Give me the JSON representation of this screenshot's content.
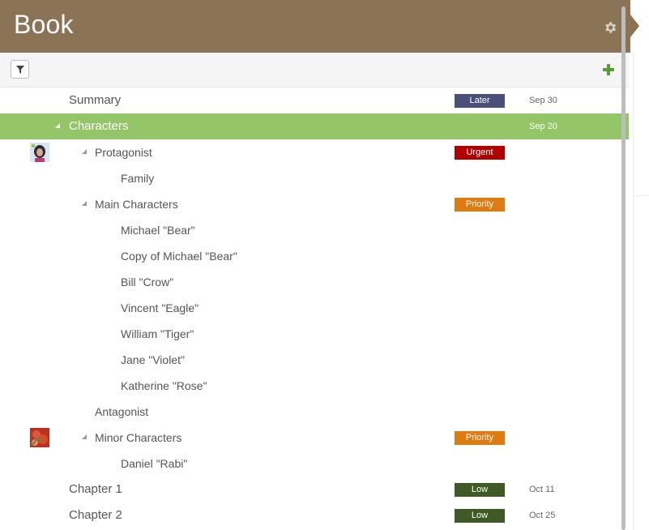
{
  "header": {
    "title": "Book"
  },
  "icons": {
    "settings": "gear-icon",
    "filter": "filter-icon",
    "add": "plus-icon"
  },
  "colors": {
    "header": "#8b7355",
    "selected_row": "#94c566",
    "badge_later": "#4a5078",
    "badge_urgent": "#b00000",
    "badge_priority": "#e07b10",
    "badge_low": "#3f5a24"
  },
  "rows": [
    {
      "label": "Summary",
      "badge": "Later",
      "date": "Sep 30"
    },
    {
      "label": "Characters",
      "date": "Sep 20"
    },
    {
      "label": "Protagonist",
      "badge": "Urgent"
    },
    {
      "label": "Family"
    },
    {
      "label": "Main Characters",
      "badge": "Priority"
    },
    {
      "label": "Michael \"Bear\""
    },
    {
      "label": "Copy of Michael \"Bear\""
    },
    {
      "label": "Bill \"Crow\""
    },
    {
      "label": "Vincent \"Eagle\""
    },
    {
      "label": "William \"Tiger\""
    },
    {
      "label": "Jane \"Violet\""
    },
    {
      "label": "Katherine \"Rose\""
    },
    {
      "label": "Antagonist"
    },
    {
      "label": "Minor Characters",
      "badge": "Priority"
    },
    {
      "label": "Daniel \"Rabi\""
    },
    {
      "label": "Chapter 1",
      "badge": "Low",
      "date": "Oct 11"
    },
    {
      "label": "Chapter 2",
      "badge": "Low",
      "date": "Oct 25"
    }
  ]
}
